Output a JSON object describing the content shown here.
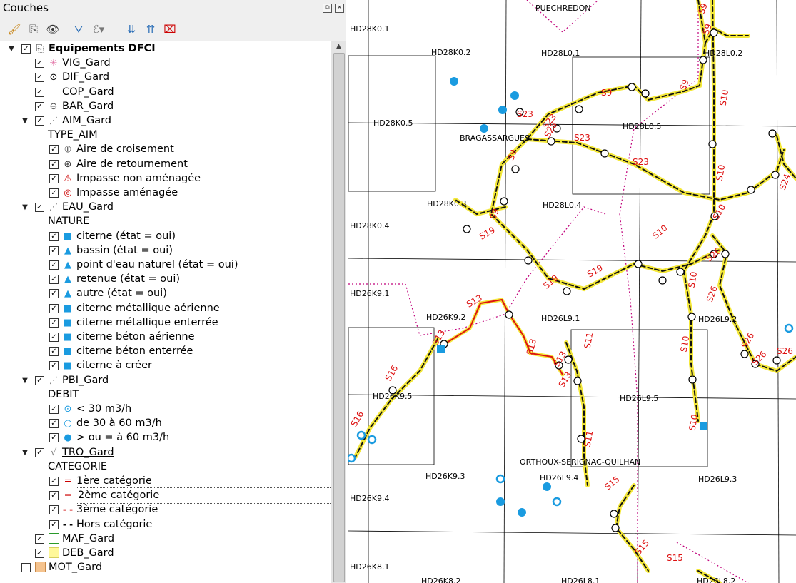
{
  "panel": {
    "title": "Couches",
    "float_btn": "⧉",
    "close_btn": "✕"
  },
  "toolbar": [
    {
      "name": "style-manager-icon",
      "glyph": "🖌"
    },
    {
      "name": "add-group-icon",
      "glyph": "⎘"
    },
    {
      "name": "visibility-icon",
      "glyph": "👁▾"
    },
    {
      "name": "filter-icon",
      "glyph": "⛛"
    },
    {
      "name": "expression-filter-icon",
      "glyph": "ℰ▾"
    },
    {
      "name": "expand-all-icon",
      "glyph": "⇊"
    },
    {
      "name": "collapse-all-icon",
      "glyph": "⇈"
    },
    {
      "name": "remove-layer-icon",
      "glyph": "⌧"
    }
  ],
  "tree": [
    {
      "type": "group",
      "label": "Equipements DFCI",
      "checked": true,
      "expanded": true,
      "icon": "group-icon",
      "glyph": "⎘"
    },
    {
      "type": "layer",
      "label": "VIG_Gard",
      "checked": true,
      "icon": "vig-asterisk-icon",
      "glyph": "✳",
      "color": "#e377a9"
    },
    {
      "type": "layer",
      "label": "DIF_Gard",
      "checked": true,
      "icon": "dif-point-icon",
      "glyph": "⊙",
      "color": "#000000"
    },
    {
      "type": "layer",
      "label": "COP_Gard",
      "checked": true,
      "icon": "",
      "glyph": ""
    },
    {
      "type": "layer",
      "label": "BAR_Gard",
      "checked": true,
      "icon": "bar-circle-icon",
      "glyph": "⊖",
      "color": "#555555"
    },
    {
      "type": "layer",
      "label": "AIM_Gard",
      "checked": true,
      "expanded": true,
      "icon": "rule-based-icon",
      "glyph": "⋰",
      "color": "#888888"
    },
    {
      "type": "header",
      "label": "TYPE_AIM"
    },
    {
      "type": "class",
      "label": "Aire de croisement",
      "checked": true,
      "icon": "crossing-area-icon",
      "glyph": "⦶",
      "color": "#333333"
    },
    {
      "type": "class",
      "label": "Aire de retournement",
      "checked": true,
      "icon": "turnaround-area-icon",
      "glyph": "⊛",
      "color": "#333333"
    },
    {
      "type": "class",
      "label": "Impasse non aménagée",
      "checked": true,
      "icon": "warning-triangle-icon",
      "glyph": "⚠",
      "color": "#cc0000"
    },
    {
      "type": "class",
      "label": "Impasse aménagée",
      "checked": true,
      "icon": "dead-end-icon",
      "glyph": "◎",
      "color": "#cc0000"
    },
    {
      "type": "layer",
      "label": "EAU_Gard",
      "checked": true,
      "expanded": true,
      "icon": "rule-based-icon",
      "glyph": "⋰",
      "color": "#888888"
    },
    {
      "type": "header",
      "label": "NATURE"
    },
    {
      "type": "class",
      "label": "citerne (état = oui)",
      "checked": true,
      "icon": "blue-square-icon",
      "glyph": "■",
      "color": "#1a9be0"
    },
    {
      "type": "class",
      "label": "bassin (état = oui)",
      "checked": true,
      "icon": "blue-triangle-icon",
      "glyph": "▲",
      "color": "#1a9be0"
    },
    {
      "type": "class",
      "label": "point d'eau naturel (état = oui)",
      "checked": true,
      "icon": "blue-triangle-icon",
      "glyph": "▲",
      "color": "#1a9be0"
    },
    {
      "type": "class",
      "label": "retenue (état = oui)",
      "checked": true,
      "icon": "blue-triangle-icon",
      "glyph": "▲",
      "color": "#1a9be0"
    },
    {
      "type": "class",
      "label": "autre (état = oui)",
      "checked": true,
      "icon": "blue-triangle-icon",
      "glyph": "▲",
      "color": "#1a9be0"
    },
    {
      "type": "class",
      "label": "citerne métallique aérienne",
      "checked": true,
      "icon": "blue-square-icon",
      "glyph": "■",
      "color": "#1a9be0"
    },
    {
      "type": "class",
      "label": "citerne métallique enterrée",
      "checked": true,
      "icon": "blue-square-icon",
      "glyph": "■",
      "color": "#1a9be0"
    },
    {
      "type": "class",
      "label": "citerne béton aérienne",
      "checked": true,
      "icon": "blue-square-icon",
      "glyph": "■",
      "color": "#1a9be0"
    },
    {
      "type": "class",
      "label": "citerne béton enterrée",
      "checked": true,
      "icon": "blue-square-icon",
      "glyph": "■",
      "color": "#1a9be0"
    },
    {
      "type": "class",
      "label": "citerne à créer",
      "checked": true,
      "icon": "blue-square-icon",
      "glyph": "■",
      "color": "#1a9be0"
    },
    {
      "type": "layer",
      "label": "PBI_Gard",
      "checked": true,
      "expanded": true,
      "icon": "rule-based-icon",
      "glyph": "⋰",
      "color": "#888888"
    },
    {
      "type": "header",
      "label": "DEBIT"
    },
    {
      "type": "class",
      "label": "< 30 m3/h",
      "checked": true,
      "icon": "blue-dot-ring-icon",
      "glyph": "⊙",
      "color": "#1a9be0"
    },
    {
      "type": "class",
      "label": "de 30 à 60 m3/h",
      "checked": true,
      "icon": "blue-ring-icon",
      "glyph": "○",
      "color": "#1a9be0"
    },
    {
      "type": "class",
      "label": "> ou = à 60 m3/h",
      "checked": true,
      "icon": "blue-dot-icon",
      "glyph": "●",
      "color": "#1a9be0"
    },
    {
      "type": "layer",
      "label": "TRO_Gard",
      "checked": true,
      "expanded": true,
      "icon": "line-rule-icon",
      "glyph": "√",
      "color": "#888888",
      "underline": true
    },
    {
      "type": "header",
      "label": "CATEGORIE"
    },
    {
      "type": "class",
      "label": "1ère catégorie",
      "checked": true,
      "icon": "double-red-line-icon",
      "glyph": "═",
      "color": "#cc0000"
    },
    {
      "type": "class",
      "label": "2ème catégorie",
      "checked": true,
      "icon": "red-line-icon",
      "glyph": "━",
      "color": "#cc0000",
      "selected": true
    },
    {
      "type": "class",
      "label": "3ème catégorie",
      "checked": true,
      "icon": "red-dashed-line-icon",
      "glyph": "- -",
      "color": "#cc0000"
    },
    {
      "type": "class",
      "label": "Hors catégorie",
      "checked": true,
      "icon": "black-dashed-line-icon",
      "glyph": "- -",
      "color": "#000000"
    },
    {
      "type": "layer",
      "label": "MAF_Gard",
      "checked": true,
      "icon": "green-outline-square-icon",
      "fill": "#ffffff",
      "border": "#2a9a2a"
    },
    {
      "type": "layer",
      "label": "DEB_Gard",
      "checked": true,
      "icon": "yellow-square-icon",
      "fill": "#fff89a",
      "border": "#d6cf60"
    },
    {
      "type": "group",
      "label": "MOT_Gard",
      "checked": false,
      "icon": "orange-square-icon",
      "fill": "#f5c38e",
      "border": "#c88a4a"
    }
  ],
  "map": {
    "labels": [
      "PUECHREDON",
      "HD28K0.1",
      "HD28K0.2",
      "HD28L0.1",
      "HD28L0.2",
      "HD28K0.5",
      "BRAGASSARGUES",
      "HD28L0.5",
      "HD28K0.3",
      "HD28L0.4",
      "HD28K0.4",
      "HD26K9.1",
      "HD26K9.2",
      "HD26L9.1",
      "HD26L9.2",
      "HD26K9.5",
      "HD26L9.5",
      "ORTHOUX-SERIGNAC-QUILHAN",
      "HD26K9.3",
      "HD26L9.4",
      "HD26L9.3",
      "HD26K9.4",
      "HD26K8.1",
      "HD26K8.2",
      "HD26L8.1",
      "HD26L8.2"
    ],
    "route_labels": [
      "S9",
      "S9",
      "S9",
      "S9",
      "S9",
      "S9",
      "S10",
      "S10",
      "S10",
      "S10",
      "S10",
      "S10",
      "S10",
      "S23",
      "S23",
      "S23",
      "S23",
      "S28",
      "S19",
      "S19",
      "S19",
      "S13",
      "S13",
      "S13",
      "S13",
      "S13",
      "S11",
      "S11",
      "S16",
      "S16",
      "S24",
      "S26",
      "S26",
      "S26",
      "S26",
      "S26",
      "S15",
      "S15",
      "S15"
    ]
  }
}
